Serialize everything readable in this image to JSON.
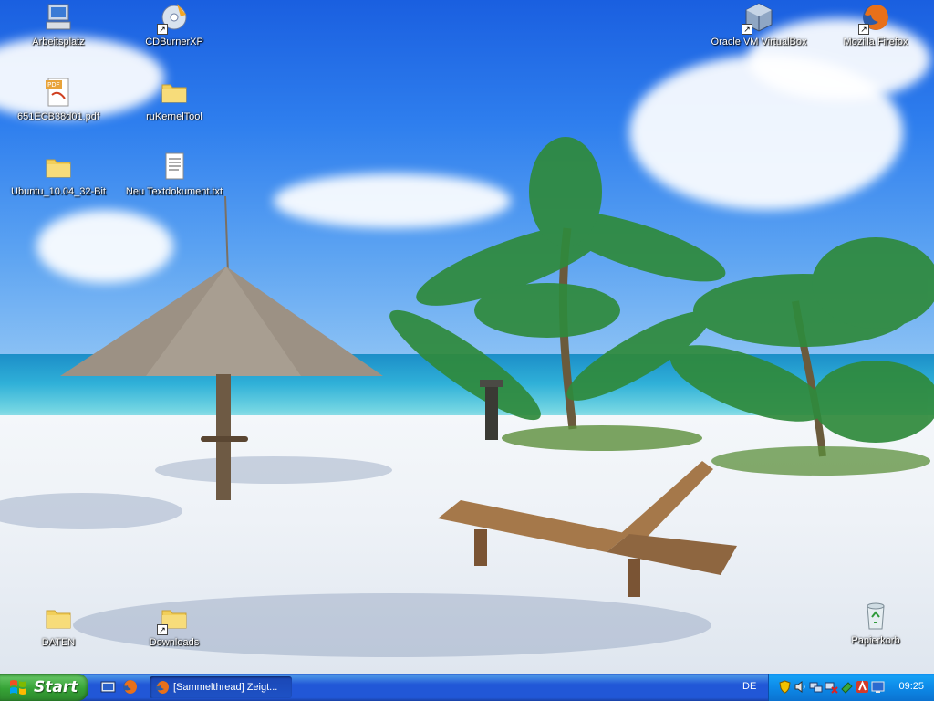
{
  "desktop": {
    "icons": [
      {
        "label": "Arbeitsplatz",
        "icon": "my-computer-icon"
      },
      {
        "label": "CDBurnerXP",
        "icon": "cd-burner-icon"
      },
      {
        "label": "651ECB38d01.pdf",
        "icon": "pdf-file-icon"
      },
      {
        "label": "ruKernelTool",
        "icon": "folder-icon"
      },
      {
        "label": "Ubuntu_10.04_32-Bit",
        "icon": "folder-icon"
      },
      {
        "label": "Neu Textdokument.txt",
        "icon": "text-file-icon"
      },
      {
        "label": "Oracle VM VirtualBox",
        "icon": "virtualbox-icon"
      },
      {
        "label": "Mozilla Firefox",
        "icon": "firefox-icon"
      },
      {
        "label": "DATEN",
        "icon": "folder-icon"
      },
      {
        "label": "Downloads",
        "icon": "folder-icon"
      },
      {
        "label": "Papierkorb",
        "icon": "recycle-bin-icon"
      }
    ]
  },
  "taskbar": {
    "start_label": "Start",
    "task": {
      "label": "[Sammelthread] Zeigt..."
    },
    "language": "DE",
    "clock": "09:25"
  },
  "colors": {
    "taskbar_blue": "#2157d7",
    "start_green": "#36a336",
    "tray_blue": "#0d8ae8"
  }
}
